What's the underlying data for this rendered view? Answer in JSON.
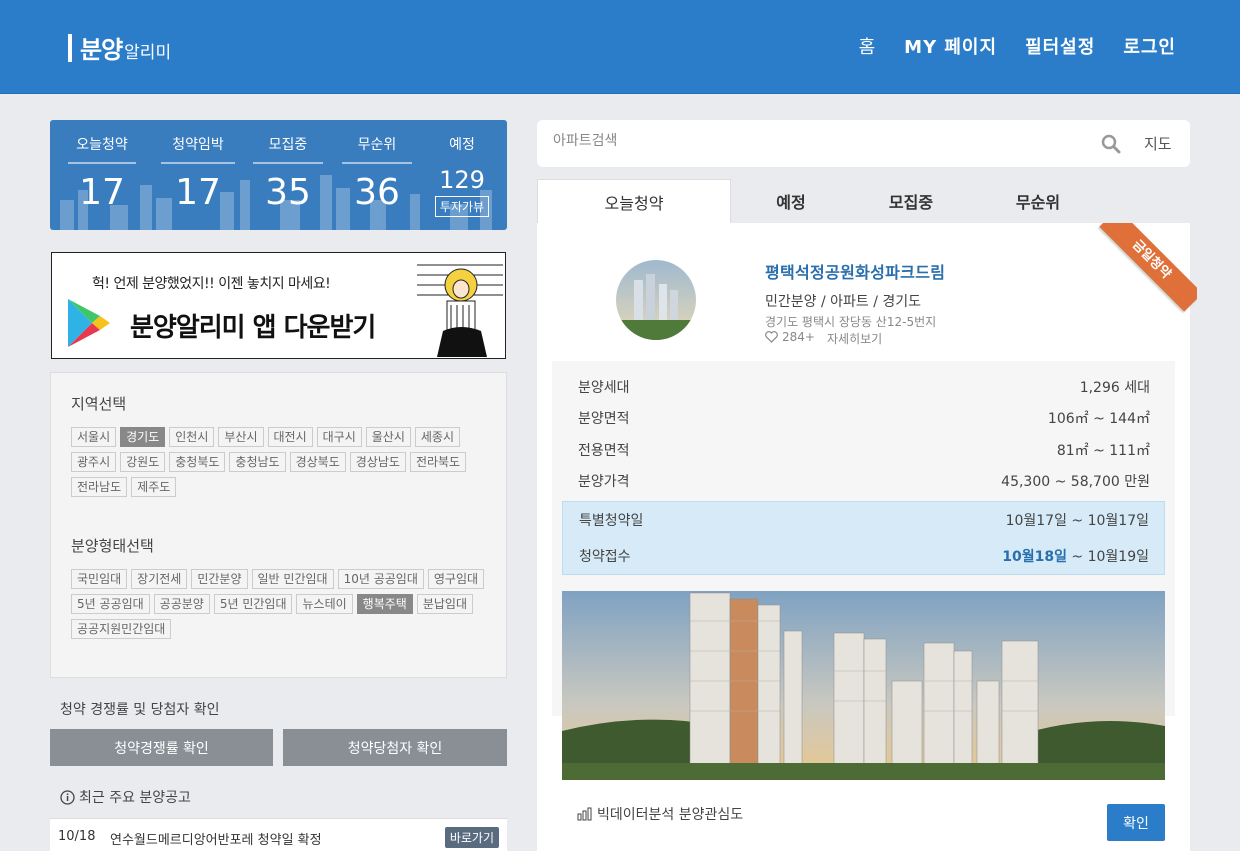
{
  "header": {
    "logo_main": "분양",
    "logo_sub": "알리미",
    "nav": [
      "홈",
      "MY 페이지",
      "필터설정",
      "로그인"
    ]
  },
  "stats": {
    "items": [
      {
        "label": "오늘청약",
        "value": "17"
      },
      {
        "label": "청약임박",
        "value": "17"
      },
      {
        "label": "모집중",
        "value": "35"
      },
      {
        "label": "무순위",
        "value": "36"
      }
    ],
    "planned": {
      "label": "예정",
      "value": "129",
      "tag": "투자가뷰"
    }
  },
  "banner": {
    "top_text": "헉! 언제 분양했었지!! 이젠 놓치지 마세요!",
    "main_text": "분양알리미 앱 다운받기"
  },
  "region": {
    "title": "지역선택",
    "items": [
      "서울시",
      "경기도",
      "인천시",
      "부산시",
      "대전시",
      "대구시",
      "울산시",
      "세종시",
      "광주시",
      "강원도",
      "충청북도",
      "충청남도",
      "경상북도",
      "경상남도",
      "전라북도",
      "전라남도",
      "제주도"
    ],
    "selected": "경기도"
  },
  "sale_type": {
    "title": "분양형태선택",
    "items": [
      "국민임대",
      "장기전세",
      "민간분양",
      "일반 민간임대",
      "10년 공공임대",
      "영구임대",
      "5년 공공임대",
      "공공분양",
      "5년 민간임대",
      "뉴스테이",
      "행복주택",
      "분납임대",
      "공공지원민간임대"
    ],
    "selected": "행복주택"
  },
  "competition": {
    "title": "청약 경쟁률 및 당첨자 확인",
    "btn_rate": "청약경쟁률 확인",
    "btn_winner": "청약당첨자 확인"
  },
  "notices": {
    "title": "최근 주요 분양공고",
    "rows": [
      {
        "date": "10/18",
        "text": "연수월드메르디앙어반포레 청약일 확정",
        "action": "바로가기"
      }
    ]
  },
  "search": {
    "placeholder": "아파트검색",
    "map_label": "지도"
  },
  "tabs": [
    "오늘청약",
    "예정",
    "모집중",
    "무순위"
  ],
  "listing": {
    "ribbon": "금일청약",
    "title": "평택석정공원화성파크드림",
    "type": "민간분양 / 아파트 / 경기도",
    "address": "경기도 평택시 장당동 산12-5번지",
    "likes": "284+",
    "more": "자세히보기",
    "info": [
      {
        "key": "분양세대",
        "value": "1,296 세대"
      },
      {
        "key": "분양면적",
        "value": "106㎡ ~ 144㎡"
      },
      {
        "key": "전용면적",
        "value": "81㎡ ~ 111㎡"
      },
      {
        "key": "분양가격",
        "value": "45,300 ~ 58,700 만원"
      }
    ],
    "special_date": {
      "key": "특별청약일",
      "value": "10월17일 ~ 10월17일"
    },
    "apply": {
      "key": "청약접수",
      "value_bold": "10월18일",
      "value_rest": " ~ 10월19일"
    },
    "analysis_label": "빅데이터분석 분양관심도",
    "confirm": "확인"
  },
  "colors": {
    "brand": "#2b7dc9",
    "accent_orange": "#e0703a",
    "highlight": "#d6ebf7"
  }
}
